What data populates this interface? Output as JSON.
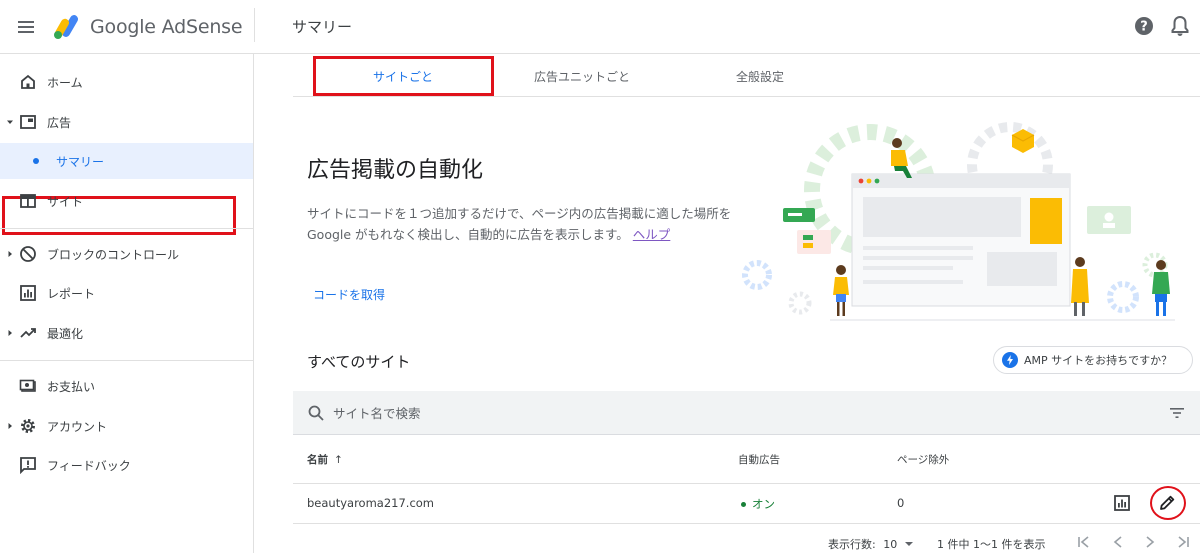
{
  "app": {
    "logo_text": "Google AdSense",
    "page_title": "サマリー"
  },
  "colors": {
    "accent": "#1a73e8",
    "highlight_red": "#e0111a",
    "status_green": "#188038"
  },
  "header": {
    "menu_icon": "menu-icon",
    "help_icon": "help-icon",
    "bell_icon": "bell-icon"
  },
  "sidebar": {
    "items": [
      {
        "label": "ホーム",
        "icon": "home-icon"
      },
      {
        "label": "広告",
        "icon": "ads-icon"
      },
      {
        "label": "サマリー",
        "icon": "dot"
      },
      {
        "label": "サイト",
        "icon": "sites-icon"
      },
      {
        "label": "ブロックのコントロール",
        "icon": "block-icon"
      },
      {
        "label": "レポート",
        "icon": "report-icon"
      },
      {
        "label": "最適化",
        "icon": "trending-icon"
      },
      {
        "label": "お支払い",
        "icon": "payment-icon"
      },
      {
        "label": "アカウント",
        "icon": "gear-icon"
      },
      {
        "label": "フィードバック",
        "icon": "feedback-icon"
      }
    ]
  },
  "tabs": [
    {
      "label": "サイトごと",
      "active": true
    },
    {
      "label": "広告ユニットごと",
      "active": false
    },
    {
      "label": "全般設定",
      "active": false
    }
  ],
  "hero": {
    "title": "広告掲載の自動化",
    "description": "サイトにコードを１つ追加するだけで、ページ内の広告掲載に適した場所を Google がもれなく検出し、自動的に広告を表示します。",
    "help_link": "ヘルプ",
    "get_code": "コードを取得"
  },
  "sites": {
    "heading": "すべてのサイト",
    "amp_button": "AMP サイトをお持ちですか？",
    "search_placeholder": "サイト名で検索",
    "columns": {
      "name": "名前",
      "sort_arrow": "↑",
      "auto_ads": "自動広告",
      "page_exclusions": "ページ除外"
    },
    "rows": [
      {
        "name": "beautyaroma217.com",
        "auto_ads": "オン",
        "page_exclusions": "0"
      }
    ],
    "pager": {
      "rows_label": "表示行数:",
      "rows_value": "10",
      "range": "1 件中 1～1 件を表示"
    }
  }
}
